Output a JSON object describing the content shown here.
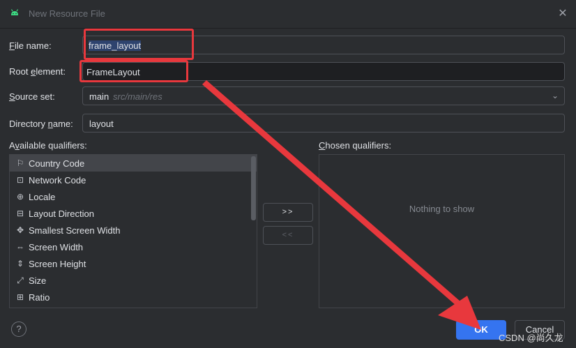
{
  "window": {
    "title": "New Resource File",
    "close_icon": "close-icon",
    "app_icon": "android-icon"
  },
  "form": {
    "file_name": {
      "label_u": "F",
      "label_rest": "ile name:",
      "value": "frame_layout"
    },
    "root_element": {
      "label_pre": "Root ",
      "label_u": "e",
      "label_rest": "lement:",
      "value": "FrameLayout"
    },
    "source_set": {
      "label_u": "S",
      "label_rest": "ource set:",
      "value": "main",
      "path": "src/main/res"
    },
    "directory_name": {
      "label_pre": "Directory ",
      "label_u": "n",
      "label_rest": "ame:",
      "value": "layout"
    }
  },
  "available_qualifiers": {
    "label_pre": "A",
    "label_u": "v",
    "label_rest": "ailable qualifiers:",
    "items": [
      {
        "label": "Country Code",
        "icon": "globe-flag-icon"
      },
      {
        "label": "Network Code",
        "icon": "network-icon"
      },
      {
        "label": "Locale",
        "icon": "globe-icon"
      },
      {
        "label": "Layout Direction",
        "icon": "direction-icon"
      },
      {
        "label": "Smallest Screen Width",
        "icon": "expand-icon"
      },
      {
        "label": "Screen Width",
        "icon": "width-icon"
      },
      {
        "label": "Screen Height",
        "icon": "height-icon"
      },
      {
        "label": "Size",
        "icon": "size-icon"
      },
      {
        "label": "Ratio",
        "icon": "ratio-icon"
      }
    ]
  },
  "buttons": {
    "add": ">>",
    "remove": "<<",
    "ok": "OK",
    "cancel": "Cancel",
    "help": "?"
  },
  "chosen_qualifiers": {
    "label_u": "C",
    "label_rest": "hosen qualifiers:",
    "empty_text": "Nothing to show"
  },
  "watermark": "CSDN @尚久龙",
  "colors": {
    "accent": "#3574f0",
    "annotation_red": "#e8383d",
    "background": "#2b2d30"
  }
}
